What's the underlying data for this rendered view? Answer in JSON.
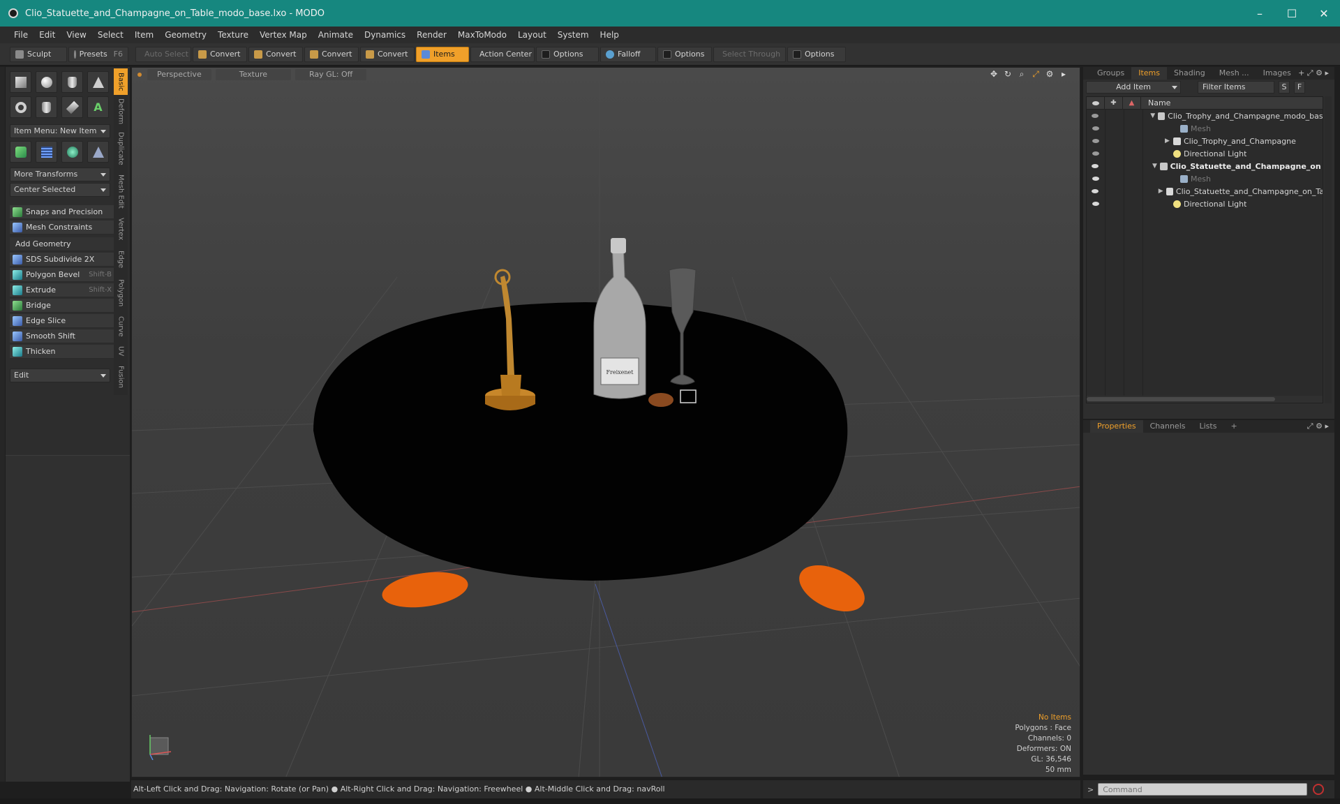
{
  "window": {
    "title": "Clio_Statuette_and_Champagne_on_Table_modo_base.lxo - MODO",
    "minimize": "–",
    "maximize": "☐",
    "close": "✕"
  },
  "menu": [
    "File",
    "Edit",
    "View",
    "Select",
    "Item",
    "Geometry",
    "Texture",
    "Vertex Map",
    "Animate",
    "Dynamics",
    "Render",
    "MaxToModo",
    "Layout",
    "System",
    "Help"
  ],
  "toolbar": {
    "sculpt": "Sculpt",
    "presets": "Presets",
    "presets_key": "F6",
    "auto_select": "Auto Select",
    "convert1": "Convert",
    "convert2": "Convert",
    "convert3": "Convert",
    "convert4": "Convert",
    "items": "Items",
    "action_center": "Action Center",
    "options1": "Options",
    "falloff": "Falloff",
    "options2": "Options",
    "select_through": "Select Through",
    "options3": "Options"
  },
  "left_panel": {
    "item_menu": "Item Menu: New Item",
    "more_transforms": "More Transforms",
    "center_selected": "Center Selected",
    "snaps": "Snaps and Precision",
    "mesh_constraints": "Mesh Constraints",
    "add_geometry": "Add Geometry",
    "tools": [
      {
        "label": "SDS Subdivide 2X",
        "key": ""
      },
      {
        "label": "Polygon Bevel",
        "key": "Shift-B"
      },
      {
        "label": "Extrude",
        "key": "Shift-X"
      },
      {
        "label": "Bridge",
        "key": ""
      },
      {
        "label": "Edge Slice",
        "key": ""
      },
      {
        "label": "Smooth Shift",
        "key": ""
      },
      {
        "label": "Thicken",
        "key": ""
      }
    ],
    "edit": "Edit",
    "vtabs": [
      "Basic",
      "Deform",
      "Duplicate",
      "Mesh Edit",
      "Vertex",
      "Edge",
      "Polygon",
      "Curve",
      "UV",
      "Fusion"
    ]
  },
  "viewport": {
    "tabs": [
      "Perspective",
      "Texture",
      "Ray GL: Off"
    ],
    "info": {
      "selection": "No Items",
      "polygons": "Polygons : Face",
      "channels": "Channels: 0",
      "deformers": "Deformers: ON",
      "gl": "GL: 36,546",
      "focal": "50 mm"
    },
    "label_text": "Freixenet"
  },
  "status": {
    "hint": "Alt-Left Click and Drag: Navigation: Rotate (or Pan) ● Alt-Right Click and Drag: Navigation: Freewheel ● Alt-Middle Click and Drag: navRoll"
  },
  "right_panel": {
    "tabs": [
      "Groups",
      "Items",
      "Shading",
      "Mesh ...",
      "Images"
    ],
    "add_item": "Add Item",
    "filter_items": "Filter Items",
    "s_btn": "S",
    "f_btn": "F",
    "name_header": "Name",
    "rows": [
      {
        "name": "Clio_Trophy_and_Champagne_modo_base ...",
        "type": "scene",
        "indent": 0,
        "arrow": "▼",
        "style": ""
      },
      {
        "name": "Mesh",
        "type": "mesh",
        "indent": 2,
        "arrow": "",
        "style": "dim"
      },
      {
        "name": "Clio_Trophy_and_Champagne",
        "type": "group",
        "indent": 1,
        "arrow": "▶",
        "style": ""
      },
      {
        "name": "Directional Light",
        "type": "light",
        "indent": 1,
        "arrow": "",
        "style": ""
      },
      {
        "name": "Clio_Statuette_and_Champagne_on ...",
        "type": "scene",
        "indent": 0,
        "arrow": "▼",
        "style": "bold"
      },
      {
        "name": "Mesh",
        "type": "mesh",
        "indent": 2,
        "arrow": "",
        "style": "dim"
      },
      {
        "name": "Clio_Statuette_and_Champagne_on_Table",
        "type": "group",
        "indent": 1,
        "arrow": "▶",
        "style": ""
      },
      {
        "name": "Directional Light",
        "type": "light",
        "indent": 1,
        "arrow": "",
        "style": ""
      }
    ],
    "prop_tabs": [
      "Properties",
      "Channels",
      "Lists"
    ],
    "add_tab": "+"
  },
  "command": {
    "prompt": ">",
    "placeholder": "Command"
  }
}
